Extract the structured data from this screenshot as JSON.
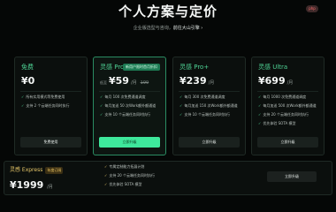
{
  "corner_badge": "php",
  "header": {
    "title": "个人方案与定价",
    "subtitle_prefix": "企业版选型与咨询，",
    "subtitle_link": "前往大山引擎 ›"
  },
  "plans": [
    {
      "name": "免费",
      "tag": "",
      "price_prefix": "",
      "price": "¥0",
      "unit": "",
      "original": "",
      "features": [
        "所有实用模式等免费使用",
        "支持 2 个云端任务同时执行"
      ],
      "button": "免费使用"
    },
    {
      "name": "灵感 Pro",
      "tag": "新用户限时首月折扣",
      "price_prefix": "低至",
      "price": "¥59",
      "unit": "/月",
      "original": "199",
      "features": [
        "每月 100 次免费通道调度",
        "每月加送 50 次Work额外额通道",
        "支持 10 个云端任务同时执行"
      ],
      "button": "立即升级"
    },
    {
      "name": "灵感 Pro+",
      "tag": "",
      "price_prefix": "",
      "price": "¥239",
      "unit": "/月",
      "original": "",
      "features": [
        "每月 300 次免费通道调度",
        "每月加送 150 次Work额外额通道",
        "支持 10 个云端任务同时执行"
      ],
      "button": "立即升级"
    },
    {
      "name": "灵感 Ultra",
      "tag": "",
      "price_prefix": "",
      "price": "¥699",
      "unit": "/月",
      "original": "",
      "features": [
        "每月 1000 次免费通道调度",
        "每月加送 500 次Work额外额通道",
        "支持 20 个云端任务同时执行",
        "优先体验 SOTA 模型"
      ],
      "button": "立即升级"
    }
  ],
  "express": {
    "name": "灵感 Express",
    "tag": "年度订阅",
    "price": "¥1999",
    "unit": "/月",
    "features": [
      "专属定制能力拓展计划",
      "支持 20 个云端任务同时执行",
      "优先体验 SOTA 模型"
    ],
    "button": "立即升级"
  }
}
